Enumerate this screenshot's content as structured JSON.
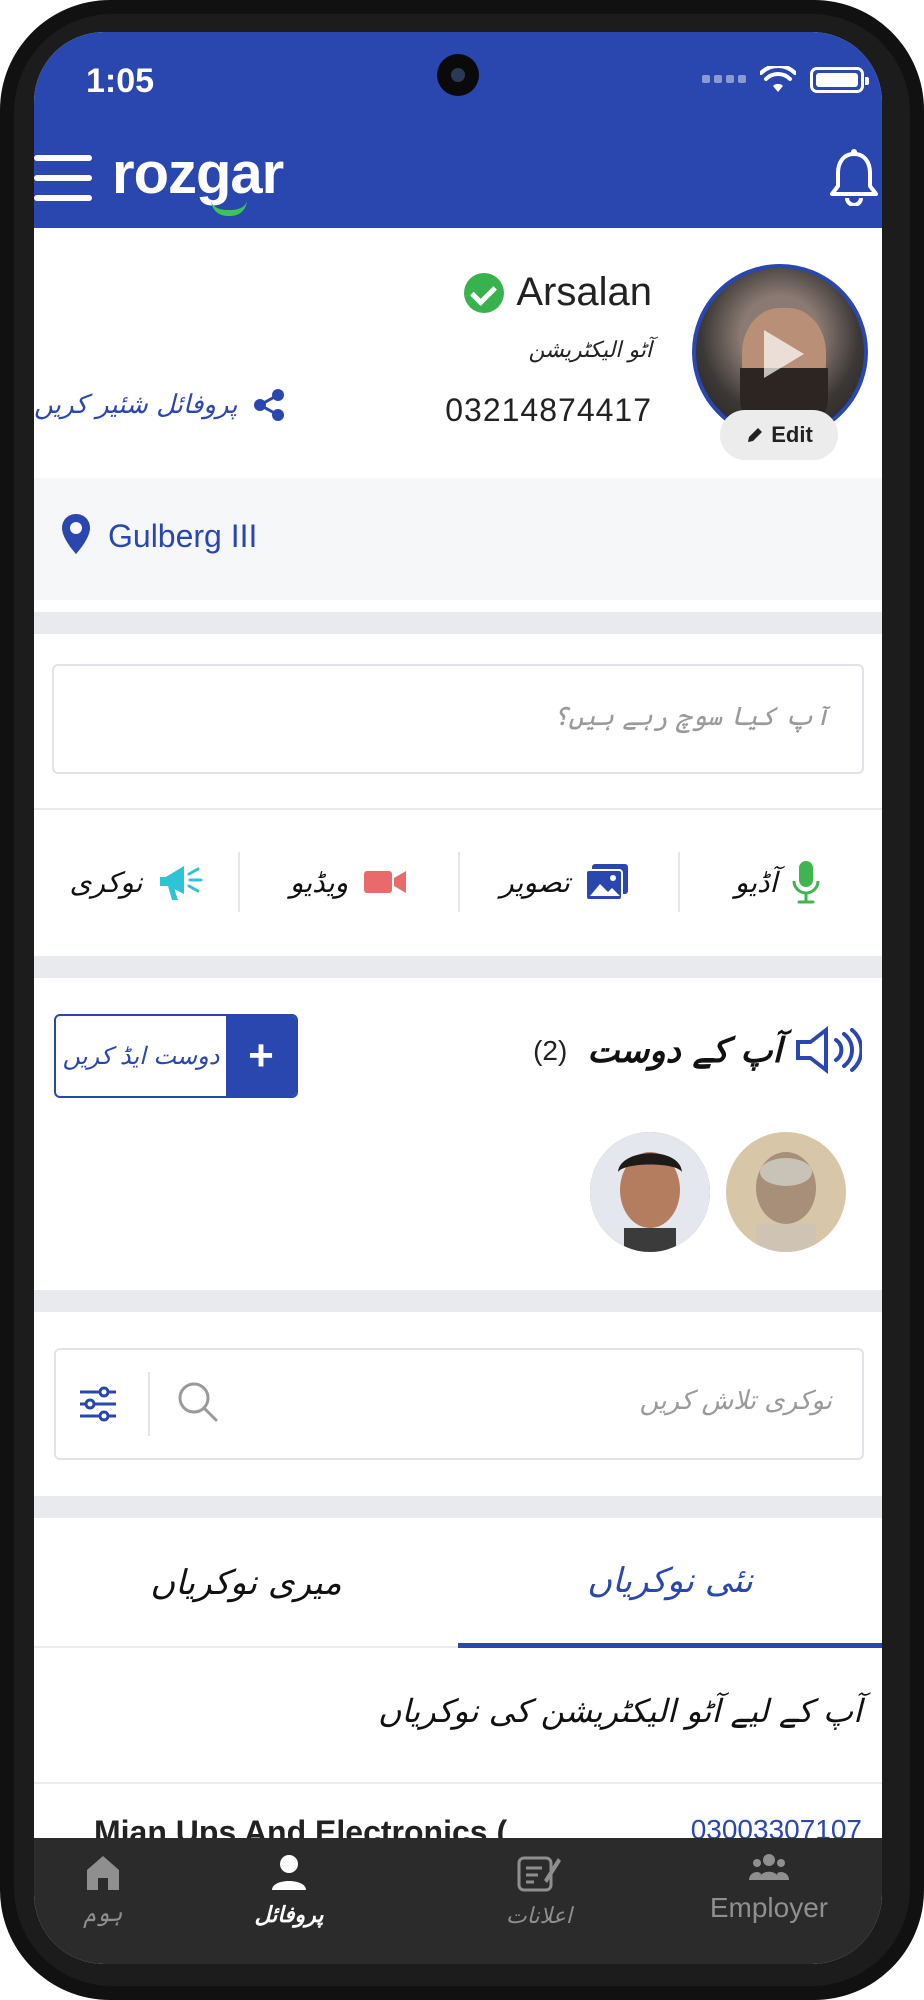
{
  "status_bar": {
    "time": "1:05"
  },
  "header": {
    "logo": "rozgar",
    "colors": {
      "brand": "#2a47b0",
      "logo_accent": "#3fc25a"
    }
  },
  "profile": {
    "name": "Arsalan",
    "profession": "آٹو الیکٹریشن",
    "phone": "03214874417",
    "edit_label": "Edit",
    "share_label": "پروفائل شئیر کریں",
    "verified": true
  },
  "location": {
    "text": "Gulberg III"
  },
  "post": {
    "placeholder": "آپ کیا سوچ رہے ہیں؟"
  },
  "actions": [
    {
      "label": "نوکری",
      "icon": "megaphone-icon",
      "color": "#2ec4d6"
    },
    {
      "label": "ویڈیو",
      "icon": "video-camera-icon",
      "color": "#e86a6a"
    },
    {
      "label": "تصویر",
      "icon": "image-icon",
      "color": "#2a47b0"
    },
    {
      "label": "آڈیو",
      "icon": "microphone-icon",
      "color": "#3fb550"
    }
  ],
  "friends": {
    "title": "آپ کے دوست",
    "count": "(2)",
    "add_label": "دوست ایڈ کریں",
    "add_plus": "+"
  },
  "search": {
    "placeholder": "نوکری تلاش کریں"
  },
  "tabs": [
    {
      "label": "میری نوکریاں",
      "active": false
    },
    {
      "label": "نئی نوکریاں",
      "active": true
    }
  ],
  "jobs": {
    "heading": "آپ کے لیے آٹو الیکٹریشن کی نوکریاں",
    "first": {
      "title": "Mian Ups And Electronics (",
      "phone": "03003307107"
    }
  },
  "bottom_nav": [
    {
      "label": "ہوم",
      "icon": "home-icon",
      "active": false
    },
    {
      "label": "پروفائل",
      "icon": "user-icon",
      "active": true
    },
    {
      "label": "اعلانات",
      "icon": "announcement-icon",
      "active": false
    },
    {
      "label": "Employer",
      "icon": "group-icon",
      "active": false
    }
  ]
}
